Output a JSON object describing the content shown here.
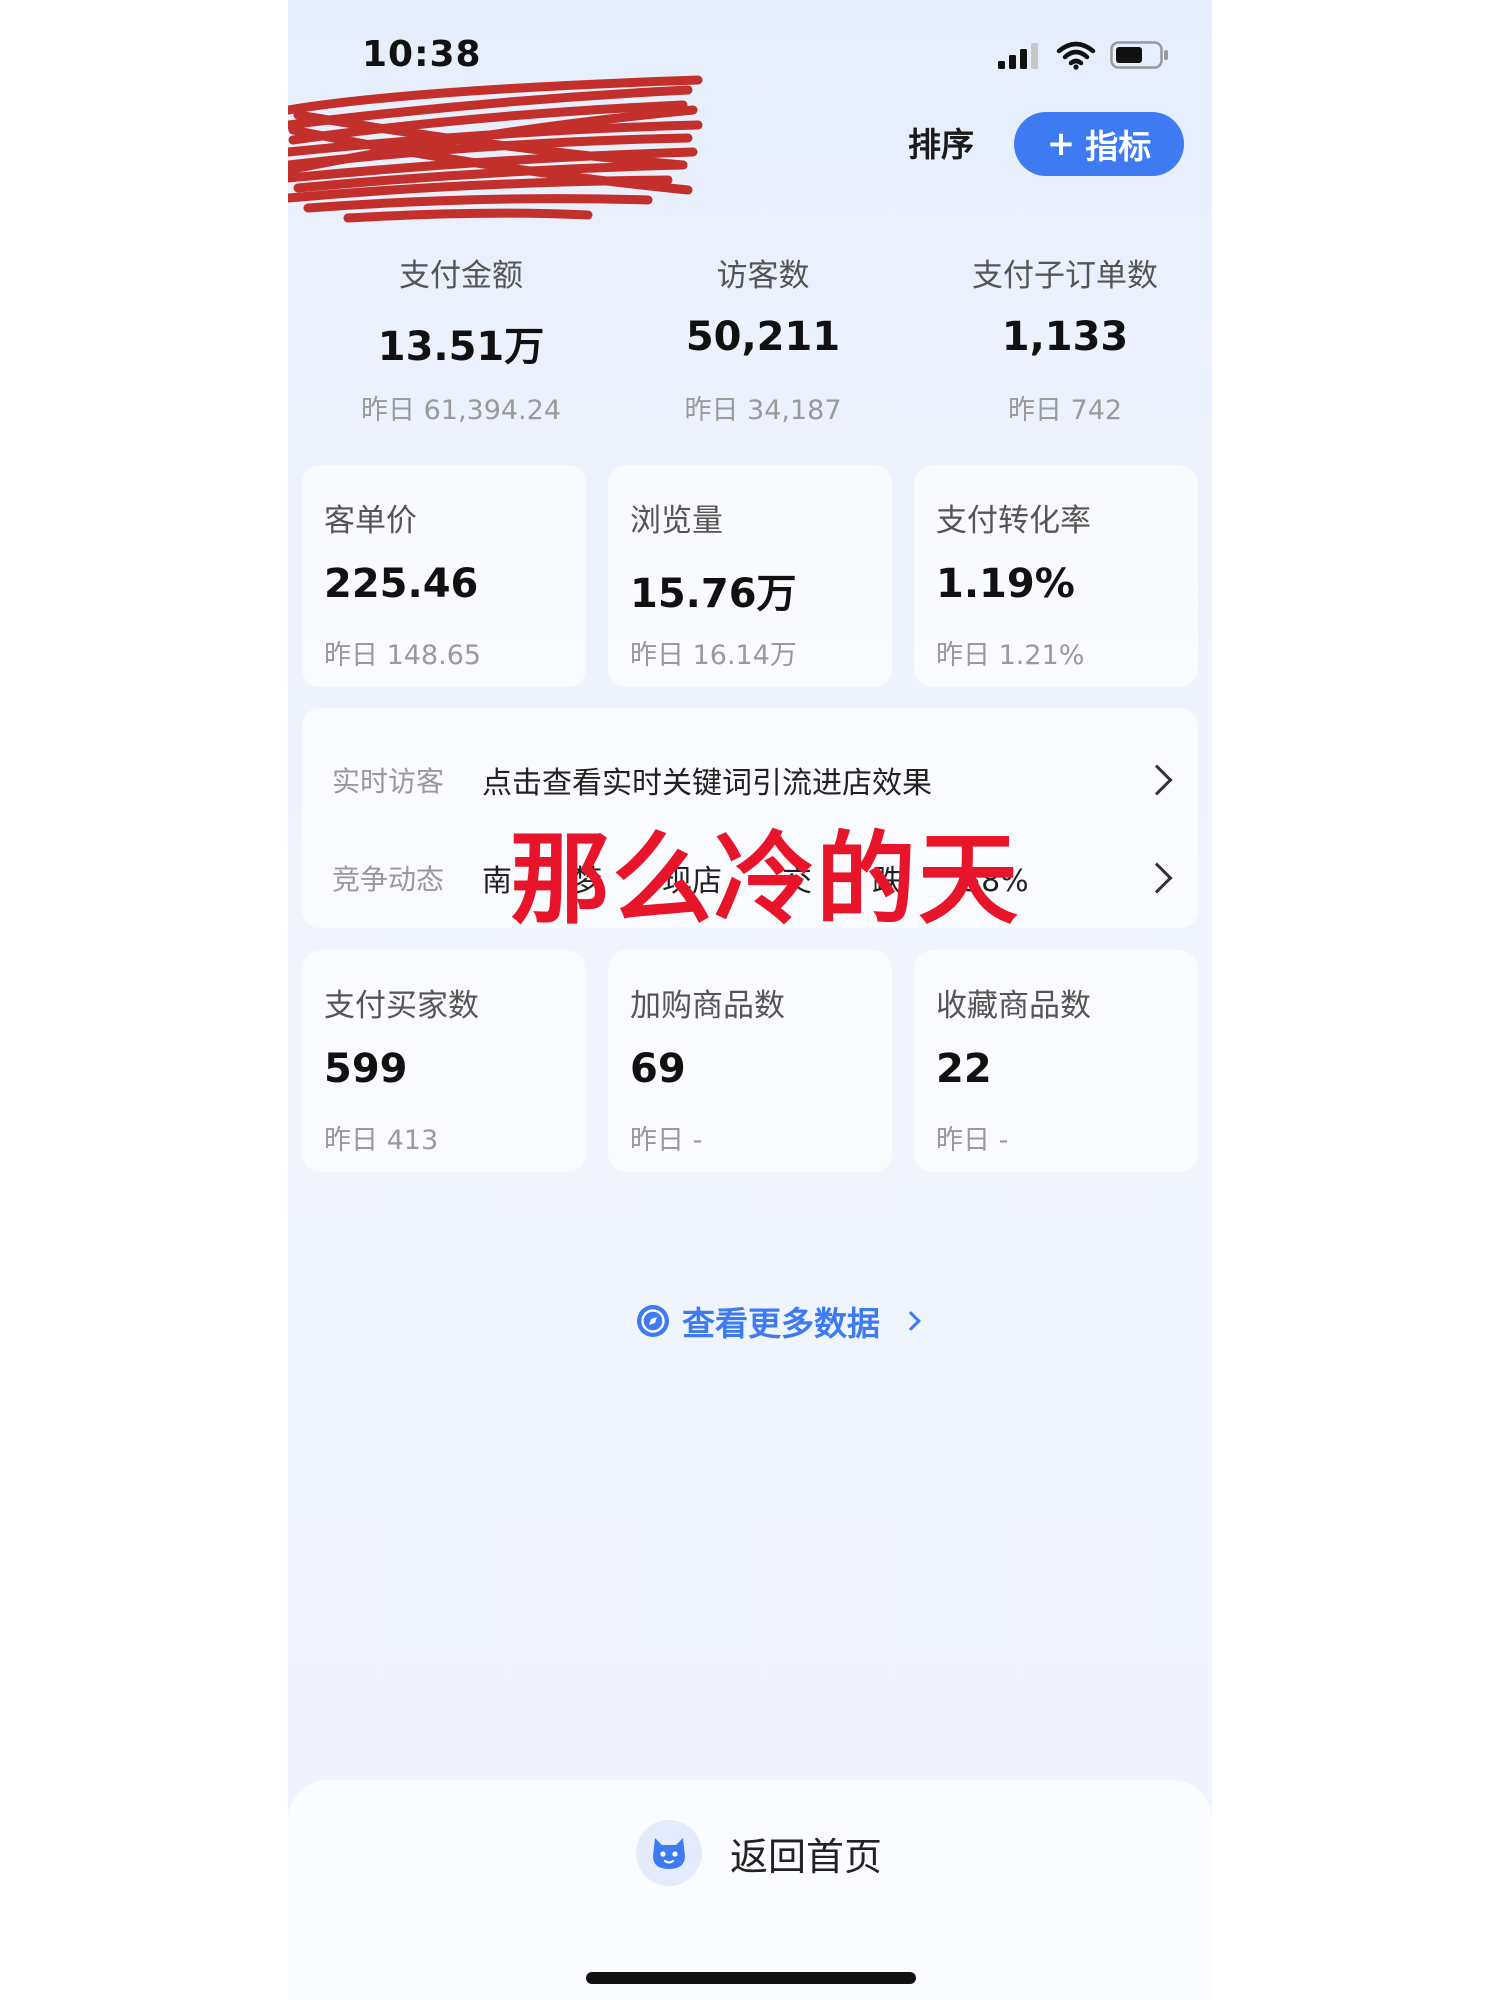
{
  "status_bar": {
    "time": "10:38"
  },
  "header": {
    "sort_label": "排序",
    "add_metric_label": "指标",
    "add_metric_symbol": "+"
  },
  "top_metrics": [
    {
      "label": "支付金额",
      "value": "13.51万",
      "prev": "昨日 61,394.24"
    },
    {
      "label": "访客数",
      "value": "50,211",
      "prev": "昨日 34,187"
    },
    {
      "label": "支付子订单数",
      "value": "1,133",
      "prev": "昨日 742"
    }
  ],
  "cards_row1": [
    {
      "label": "客单价",
      "value": "225.46",
      "prev": "昨日 148.65"
    },
    {
      "label": "浏览量",
      "value": "15.76万",
      "prev": "昨日 16.14万"
    },
    {
      "label": "支付转化率",
      "value": "1.19%",
      "prev": "昨日 1.21%"
    }
  ],
  "info_rows": [
    {
      "tag": "实时访客",
      "text": "点击查看实时关键词引流进店效果"
    },
    {
      "tag": "竞争动态",
      "text": "南　　梦　　现店　　交　　跌　　58%"
    }
  ],
  "cards_row2": [
    {
      "label": "支付买家数",
      "value": "599",
      "prev": "昨日 413"
    },
    {
      "label": "加购商品数",
      "value": "69",
      "prev": "昨日 -"
    },
    {
      "label": "收藏商品数",
      "value": "22",
      "prev": "昨日 -"
    }
  ],
  "overlay_caption": "那么冷的天",
  "more_data": {
    "label": "查看更多数据"
  },
  "bottom_bar": {
    "home_label": "返回首页"
  },
  "colors": {
    "accent": "#3e7bf3",
    "overlay_red": "#e8152a",
    "redaction_red": "#c0201a"
  }
}
